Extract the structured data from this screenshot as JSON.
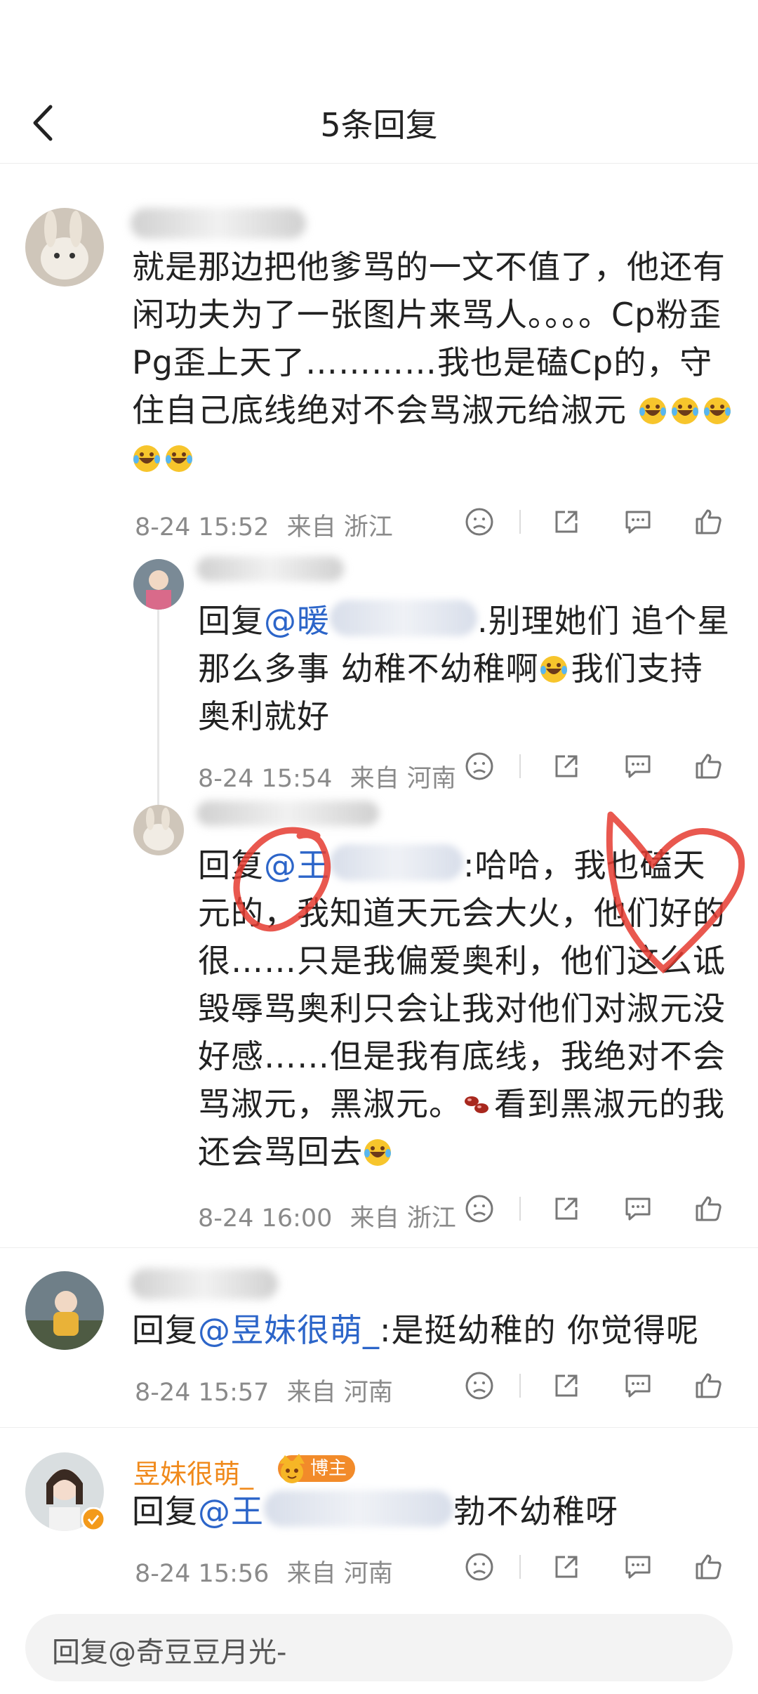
{
  "header": {
    "title": "5条回复",
    "back_icon": "back-arrow-icon"
  },
  "comments": [
    {
      "text": "就是那边把他爹骂的一文不值了，他还有闲功夫为了一张图片来骂人。。。。Cp粉歪Pg歪上天了…………我也是磕Cp的，守住自己底线绝对不会骂淑元给淑元",
      "emoji_count": 5,
      "emoji_icon": "laughing-crying-emoji-icon",
      "time": "8-24 15:52",
      "location": "来自 浙江"
    },
    {
      "reply_prefix": "回复",
      "mention": "@暖",
      "mention_tail": ".别理她们 追个星那么多事 幼稚不幼稚啊",
      "text_after_emoji": "我们支持奥利就好",
      "time": "8-24 15:54",
      "location": "来自 河南"
    },
    {
      "reply_prefix": "回复",
      "mention": "@王",
      "after_mention": ":哈哈，我也磕天元的，我知道天元会大火，他们好的很……只是我偏爱奥利，他们这么诋毁辱骂奥利只会让我对他们对淑元没好感……但是我有底线，我绝对不会骂淑元，黑淑元。",
      "bean_icon": "red-bean-emoji-icon",
      "after_bean": "看到黑淑元的我还会骂回去",
      "time": "8-24 16:00",
      "location": "来自 浙江"
    },
    {
      "reply_prefix": "回复",
      "mention": "@昱妹很萌_",
      "after_mention": ":是挺幼稚的 你觉得呢",
      "time": "8-24 15:57",
      "location": "来自 河南"
    },
    {
      "author": "昱妹很萌_",
      "badge": "博主",
      "reply_prefix": "回复",
      "mention": "@王",
      "after_mention": "勃不幼稚呀",
      "time": "8-24 15:56",
      "location": "来自 河南"
    }
  ],
  "actions": {
    "icons": [
      "dislike-face-icon",
      "share-icon",
      "comment-icon",
      "like-icon"
    ]
  },
  "reply_bar": {
    "placeholder": "回复@奇豆豆月光-"
  },
  "colors": {
    "mention": "#2c65c9",
    "blogger": "#f08a1c",
    "meta": "#8a8a8a"
  }
}
